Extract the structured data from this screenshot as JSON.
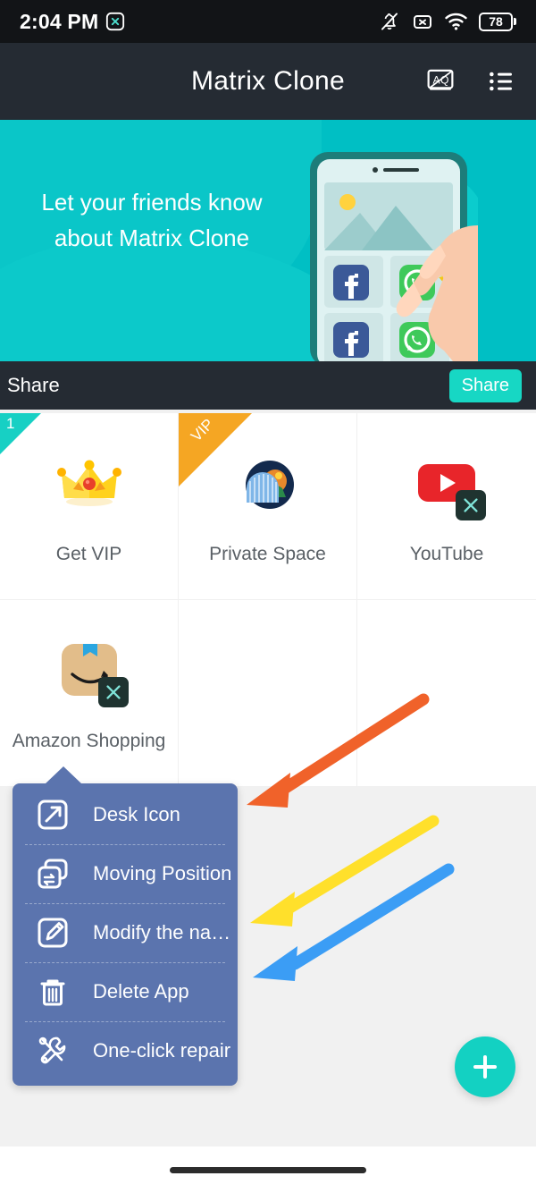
{
  "status_bar": {
    "time": "2:04 PM",
    "icons": [
      "close-circle-icon",
      "bell-muted-icon",
      "x-box-icon",
      "wifi-icon"
    ],
    "battery_percent": "78"
  },
  "app_bar": {
    "title": "Matrix Clone",
    "actions": [
      {
        "name": "translate-icon",
        "label": "Translate"
      },
      {
        "name": "list-menu-icon",
        "label": "List"
      }
    ]
  },
  "banner": {
    "text_line1": "Let your friends know",
    "text_line2": "about Matrix Clone",
    "bg_color": "#00bfc4",
    "illustration": "hand-tapping-phone-with-cloned-apps"
  },
  "share_bar": {
    "label": "Share",
    "button_label": "Share",
    "button_color": "#17d7c4"
  },
  "grid": {
    "cells": [
      {
        "name": "get-vip",
        "label": "Get VIP",
        "icon": "crown-icon",
        "badge": "1",
        "badge_color": "#17d0c4",
        "ribbon": null,
        "cloned": false
      },
      {
        "name": "private-space",
        "label": "Private Space",
        "icon": "private-space-icon",
        "badge": null,
        "ribbon": "VIP",
        "ribbon_color": "#f5a623",
        "cloned": false
      },
      {
        "name": "youtube",
        "label": "YouTube",
        "icon": "youtube-icon",
        "badge": null,
        "ribbon": null,
        "cloned": true
      },
      {
        "name": "amazon-shopping",
        "label": "Amazon Shopping",
        "icon": "amazon-icon",
        "badge": null,
        "ribbon": null,
        "cloned": true
      },
      {
        "name": "empty-slot-1",
        "label": "",
        "icon": null,
        "badge": null,
        "ribbon": null,
        "cloned": false
      },
      {
        "name": "empty-slot-2",
        "label": "",
        "icon": null,
        "badge": null,
        "ribbon": null,
        "cloned": false
      }
    ]
  },
  "context_menu": {
    "bg_color": "#5b74ae",
    "items": [
      {
        "label": "Desk Icon",
        "icon": "external-link-icon"
      },
      {
        "label": "Moving Position",
        "icon": "move-copy-icon"
      },
      {
        "label": "Modify the na…",
        "icon": "edit-pencil-icon"
      },
      {
        "label": "Delete App",
        "icon": "trash-icon"
      },
      {
        "label": "One-click repair",
        "icon": "wrench-screwdriver-icon"
      }
    ]
  },
  "annotations": {
    "arrows": [
      {
        "name": "arrow-orange",
        "color": "#f0622a",
        "points_to": "Desk Icon"
      },
      {
        "name": "arrow-yellow",
        "color": "#ffe02b",
        "points_to": "Modify the na…"
      },
      {
        "name": "arrow-blue",
        "color": "#3b9df5",
        "points_to": "Delete App"
      }
    ]
  },
  "fab": {
    "label": "+",
    "color": "#13d1c2",
    "name": "add-app-button"
  },
  "nav_bar": {
    "gesture_pill": true
  }
}
